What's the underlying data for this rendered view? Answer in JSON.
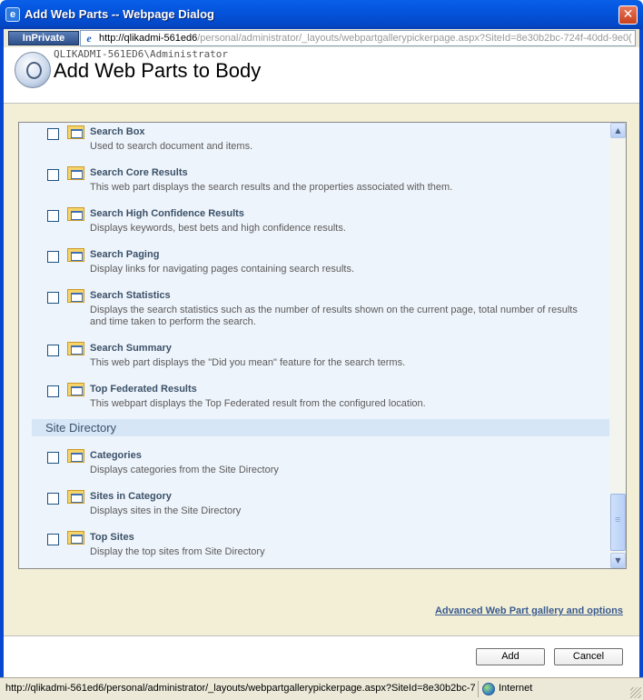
{
  "window": {
    "title": "Add Web Parts -- Webpage Dialog",
    "close_glyph": "✕"
  },
  "address_bar": {
    "inprivate_label": "InPrivate",
    "url_host": "http://qlikadmi-561ed6",
    "url_path": "/personal/administrator/_layouts/webpartgallerypickerpage.aspx?SiteId=8e30b2bc-724f-40dd-9e0("
  },
  "header": {
    "user": "QLIKADMI-561ED6\\Administrator",
    "title": "Add Web Parts to Body"
  },
  "web_parts": [
    {
      "name": "Search Box",
      "description": "Used to search document and items."
    },
    {
      "name": "Search Core Results",
      "description": "This web part displays the search results and the properties associated with them."
    },
    {
      "name": "Search High Confidence Results",
      "description": "Displays keywords, best bets and high confidence results."
    },
    {
      "name": "Search Paging",
      "description": "Display links for navigating pages containing search results."
    },
    {
      "name": "Search Statistics",
      "description": "Displays the search statistics such as the number of results shown on the current page, total number of results and time taken to perform the search."
    },
    {
      "name": "Search Summary",
      "description": "This web part displays the \"Did you mean\" feature for the search terms."
    },
    {
      "name": "Top Federated Results",
      "description": "This webpart displays the Top Federated result from the configured location."
    }
  ],
  "section": {
    "title": "Site Directory",
    "web_parts": [
      {
        "name": "Categories",
        "description": "Displays categories from the Site Directory"
      },
      {
        "name": "Sites in Category",
        "description": "Displays sites in the Site Directory"
      },
      {
        "name": "Top Sites",
        "description": "Display the top sites from Site Directory"
      }
    ]
  },
  "advanced_link": "Advanced Web Part gallery and options",
  "buttons": {
    "add": "Add",
    "cancel": "Cancel"
  },
  "status_bar": {
    "url": "http://qlikadmi-561ed6/personal/administrator/_layouts/webpartgallerypickerpage.aspx?SiteId=8e30b2bc-7",
    "zone": "Internet"
  },
  "scrollbar": {
    "up_glyph": "▲",
    "down_glyph": "▼"
  }
}
